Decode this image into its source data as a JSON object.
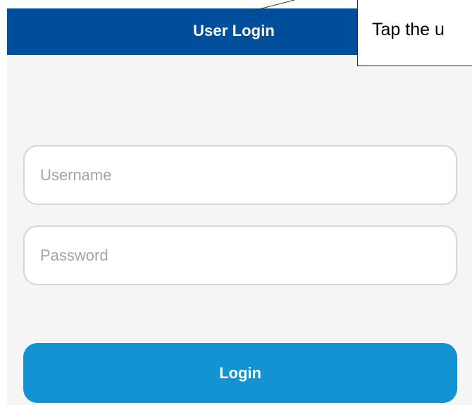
{
  "header": {
    "title": "User Login"
  },
  "form": {
    "username": {
      "placeholder": "Username",
      "value": ""
    },
    "password": {
      "placeholder": "Password",
      "value": ""
    },
    "login_label": "Login"
  },
  "annotation": {
    "text": "Tap the u"
  },
  "colors": {
    "header_bg": "#004f9d",
    "button_bg": "#1493d3",
    "screen_bg": "#f5f5f5",
    "field_border": "#d6d6d6",
    "placeholder": "#a4a4a4"
  }
}
